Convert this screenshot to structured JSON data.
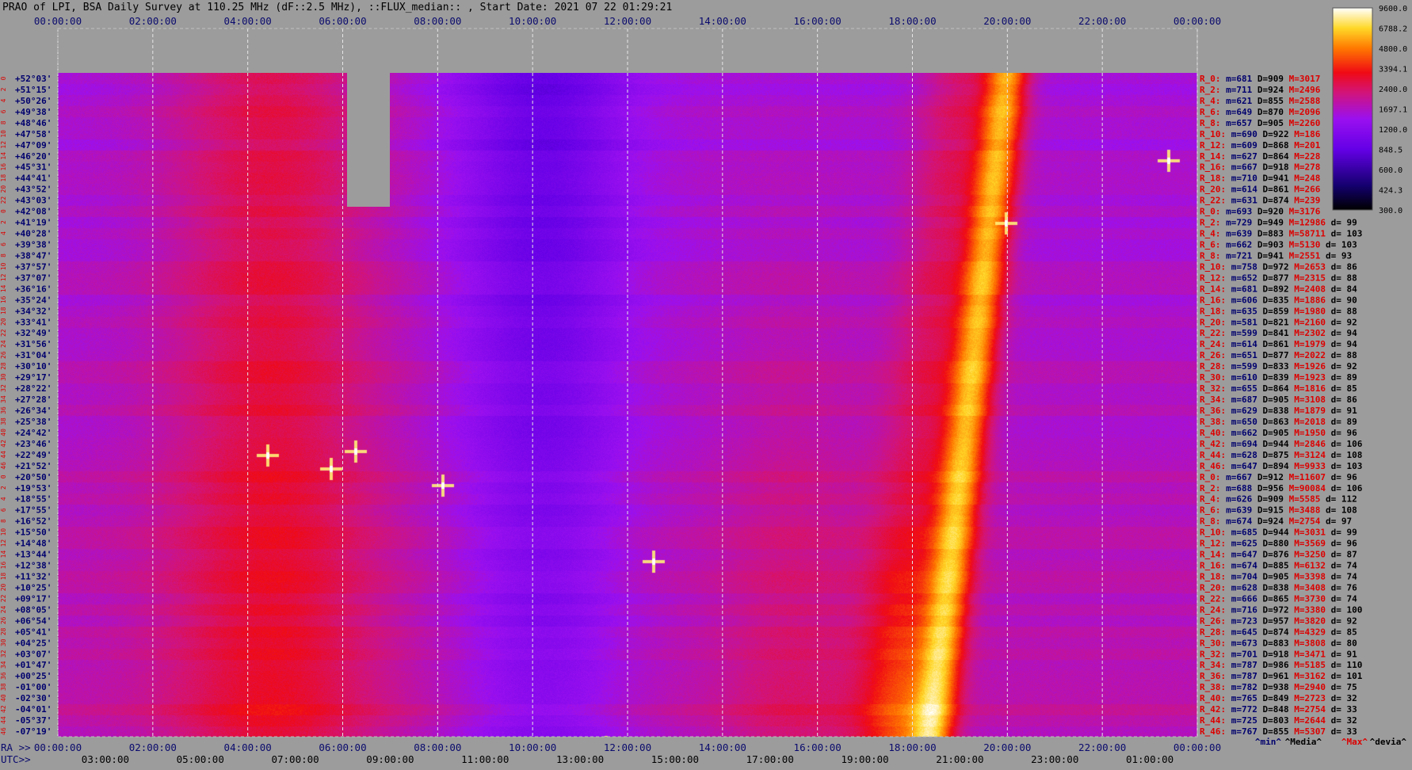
{
  "title": "PRAO of LPI, BSA Daily Survey at 110.25 MHz (dF::2.5 MHz), ::FLUX_median:: , Start Date: 2021 07 22 01:29:21",
  "colors": {
    "background": "#9c9c9c",
    "grid": "#e6e6e6",
    "label_dark": "#00006e",
    "label_red": "#dc0000"
  },
  "chart_data": {
    "type": "heatmap",
    "title": "PRAO of LPI, BSA Daily Survey at 110.25 MHz (dF::2.5 MHz), ::FLUX_median:: , Start Date: 2021 07 22 01:29:21",
    "top_axis_ticks": [
      "00:00:00",
      "02:00:00",
      "04:00:00",
      "06:00:00",
      "08:00:00",
      "10:00:00",
      "12:00:00",
      "14:00:00",
      "16:00:00",
      "18:00:00",
      "20:00:00",
      "22:00:00",
      "00:00:00"
    ],
    "ra_axis_prefix": "RA >>",
    "ra_axis_ticks": [
      "00:00:00",
      "02:00:00",
      "04:00:00",
      "06:00:00",
      "08:00:00",
      "10:00:00",
      "12:00:00",
      "14:00:00",
      "16:00:00",
      "18:00:00",
      "20:00:00",
      "22:00:00",
      "00:00:00"
    ],
    "utc_axis_prefix": "UTC>>",
    "utc_axis_ticks": [
      "03:00:00",
      "05:00:00",
      "07:00:00",
      "09:00:00",
      "11:00:00",
      "13:00:00",
      "15:00:00",
      "17:00:00",
      "19:00:00",
      "21:00:00",
      "23:00:00",
      "01:00:00"
    ],
    "declinations": [
      "+52°03'",
      "+51°15'",
      "+50°26'",
      "+49°38'",
      "+48°46'",
      "+47°58'",
      "+47°09'",
      "+46°20'",
      "+45°31'",
      "+44°41'",
      "+43°52'",
      "+43°03'",
      "+42°08'",
      "+41°19'",
      "+40°28'",
      "+39°38'",
      "+38°47'",
      "+37°57'",
      "+37°07'",
      "+36°16'",
      "+35°24'",
      "+34°32'",
      "+33°41'",
      "+32°49'",
      "+31°56'",
      "+31°04'",
      "+30°10'",
      "+29°17'",
      "+28°22'",
      "+27°28'",
      "+26°34'",
      "+25°38'",
      "+24°42'",
      "+23°46'",
      "+22°49'",
      "+21°52'",
      "+20°50'",
      "+19°53'",
      "+18°55'",
      "+17°55'",
      "+16°52'",
      "+15°50'",
      "+14°48'",
      "+13°44'",
      "+12°38'",
      "+11°32'",
      "+10°25'",
      "+09°17'",
      "+08°05'",
      "+06°54'",
      "+05°41'",
      "+04°25'",
      "+03°07'",
      "+01°47'",
      "+00°25'",
      "-01°00'",
      "-02°30'",
      "-04°01'",
      "-05°37'",
      "-07°19'"
    ],
    "beam_numbers": [
      "0",
      "2",
      "4",
      "6",
      "8",
      "10",
      "12",
      "14",
      "16",
      "18",
      "20",
      "22",
      "0",
      "2",
      "4",
      "6",
      "8",
      "10",
      "12",
      "14",
      "16",
      "18",
      "20",
      "22",
      "24",
      "26",
      "28",
      "30",
      "32",
      "34",
      "36",
      "38",
      "40",
      "42",
      "44",
      "46",
      "0",
      "2",
      "4",
      "6",
      "8",
      "10",
      "12",
      "14",
      "16",
      "18",
      "20",
      "22",
      "24",
      "26",
      "28",
      "30",
      "32",
      "34",
      "36",
      "38",
      "40",
      "42",
      "44",
      "46"
    ],
    "colorbar": {
      "ticks": [
        "9600.0",
        "6788.2",
        "4800.0",
        "3394.1",
        "2400.0",
        "1697.1",
        "1200.0",
        "848.5",
        "600.0",
        "424.3",
        "300.0"
      ],
      "range": [
        300,
        9600
      ],
      "scale": "log"
    },
    "row_stats": [
      {
        "beam": "R_0:",
        "m": "681",
        "D": "909",
        "M": "3017",
        "d": ""
      },
      {
        "beam": "R_2:",
        "m": "711",
        "D": "924",
        "M": "2496",
        "d": ""
      },
      {
        "beam": "R_4:",
        "m": "621",
        "D": "855",
        "M": "2588",
        "d": ""
      },
      {
        "beam": "R_6:",
        "m": "649",
        "D": "870",
        "M": "2096",
        "d": ""
      },
      {
        "beam": "R_8:",
        "m": "657",
        "D": "905",
        "M": "2260",
        "d": ""
      },
      {
        "beam": "R_10:",
        "m": "690",
        "D": "922",
        "M": "186",
        "d": ""
      },
      {
        "beam": "R_12:",
        "m": "609",
        "D": "868",
        "M": "201",
        "d": ""
      },
      {
        "beam": "R_14:",
        "m": "627",
        "D": "864",
        "M": "228",
        "d": ""
      },
      {
        "beam": "R_16:",
        "m": "667",
        "D": "918",
        "M": "278",
        "d": ""
      },
      {
        "beam": "R_18:",
        "m": "710",
        "D": "941",
        "M": "248",
        "d": ""
      },
      {
        "beam": "R_20:",
        "m": "614",
        "D": "861",
        "M": "266",
        "d": ""
      },
      {
        "beam": "R_22:",
        "m": "631",
        "D": "874",
        "M": "239",
        "d": ""
      },
      {
        "beam": "R_0:",
        "m": "693",
        "D": "920",
        "M": "3176",
        "d": ""
      },
      {
        "beam": "R_2:",
        "m": "729",
        "D": "949",
        "M": "12986",
        "d": "99"
      },
      {
        "beam": "R_4:",
        "m": "639",
        "D": "883",
        "M": "58711",
        "d": "103"
      },
      {
        "beam": "R_6:",
        "m": "662",
        "D": "903",
        "M": "5130",
        "d": "103"
      },
      {
        "beam": "R_8:",
        "m": "721",
        "D": "941",
        "M": "2551",
        "d": "93"
      },
      {
        "beam": "R_10:",
        "m": "758",
        "D": "972",
        "M": "2653",
        "d": "86"
      },
      {
        "beam": "R_12:",
        "m": "652",
        "D": "877",
        "M": "2315",
        "d": "88"
      },
      {
        "beam": "R_14:",
        "m": "681",
        "D": "892",
        "M": "2408",
        "d": "84"
      },
      {
        "beam": "R_16:",
        "m": "606",
        "D": "835",
        "M": "1886",
        "d": "90"
      },
      {
        "beam": "R_18:",
        "m": "635",
        "D": "859",
        "M": "1980",
        "d": "88"
      },
      {
        "beam": "R_20:",
        "m": "581",
        "D": "821",
        "M": "2160",
        "d": "92"
      },
      {
        "beam": "R_22:",
        "m": "599",
        "D": "841",
        "M": "2302",
        "d": "94"
      },
      {
        "beam": "R_24:",
        "m": "614",
        "D": "861",
        "M": "1979",
        "d": "94"
      },
      {
        "beam": "R_26:",
        "m": "651",
        "D": "877",
        "M": "2022",
        "d": "88"
      },
      {
        "beam": "R_28:",
        "m": "599",
        "D": "833",
        "M": "1926",
        "d": "92"
      },
      {
        "beam": "R_30:",
        "m": "610",
        "D": "839",
        "M": "1923",
        "d": "89"
      },
      {
        "beam": "R_32:",
        "m": "655",
        "D": "864",
        "M": "1816",
        "d": "85"
      },
      {
        "beam": "R_34:",
        "m": "687",
        "D": "905",
        "M": "3108",
        "d": "86"
      },
      {
        "beam": "R_36:",
        "m": "629",
        "D": "838",
        "M": "1879",
        "d": "91"
      },
      {
        "beam": "R_38:",
        "m": "650",
        "D": "863",
        "M": "2018",
        "d": "89"
      },
      {
        "beam": "R_40:",
        "m": "662",
        "D": "905",
        "M": "1950",
        "d": "96"
      },
      {
        "beam": "R_42:",
        "m": "694",
        "D": "944",
        "M": "2846",
        "d": "106"
      },
      {
        "beam": "R_44:",
        "m": "628",
        "D": "875",
        "M": "3124",
        "d": "108"
      },
      {
        "beam": "R_46:",
        "m": "647",
        "D": "894",
        "M": "9933",
        "d": "103"
      },
      {
        "beam": "R_0:",
        "m": "667",
        "D": "912",
        "M": "11607",
        "d": "96"
      },
      {
        "beam": "R_2:",
        "m": "688",
        "D": "956",
        "M": "90084",
        "d": "106"
      },
      {
        "beam": "R_4:",
        "m": "626",
        "D": "909",
        "M": "5585",
        "d": "112"
      },
      {
        "beam": "R_6:",
        "m": "639",
        "D": "915",
        "M": "3488",
        "d": "108"
      },
      {
        "beam": "R_8:",
        "m": "674",
        "D": "924",
        "M": "2754",
        "d": "97"
      },
      {
        "beam": "R_10:",
        "m": "685",
        "D": "944",
        "M": "3031",
        "d": "99"
      },
      {
        "beam": "R_12:",
        "m": "625",
        "D": "880",
        "M": "3569",
        "d": "96"
      },
      {
        "beam": "R_14:",
        "m": "647",
        "D": "876",
        "M": "3250",
        "d": "87"
      },
      {
        "beam": "R_16:",
        "m": "674",
        "D": "885",
        "M": "6132",
        "d": "74"
      },
      {
        "beam": "R_18:",
        "m": "704",
        "D": "905",
        "M": "3398",
        "d": "74"
      },
      {
        "beam": "R_20:",
        "m": "628",
        "D": "838",
        "M": "3408",
        "d": "76"
      },
      {
        "beam": "R_22:",
        "m": "666",
        "D": "865",
        "M": "3730",
        "d": "74"
      },
      {
        "beam": "R_24:",
        "m": "716",
        "D": "972",
        "M": "3380",
        "d": "100"
      },
      {
        "beam": "R_26:",
        "m": "723",
        "D": "957",
        "M": "3820",
        "d": "92"
      },
      {
        "beam": "R_28:",
        "m": "645",
        "D": "874",
        "M": "4329",
        "d": "85"
      },
      {
        "beam": "R_30:",
        "m": "673",
        "D": "883",
        "M": "3808",
        "d": "80"
      },
      {
        "beam": "R_32:",
        "m": "701",
        "D": "918",
        "M": "3471",
        "d": "91"
      },
      {
        "beam": "R_34:",
        "m": "787",
        "D": "986",
        "M": "5185",
        "d": "110"
      },
      {
        "beam": "R_36:",
        "m": "787",
        "D": "961",
        "M": "3162",
        "d": "101"
      },
      {
        "beam": "R_38:",
        "m": "782",
        "D": "938",
        "M": "2940",
        "d": "75"
      },
      {
        "beam": "R_40:",
        "m": "765",
        "D": "849",
        "M": "2723",
        "d": "32"
      },
      {
        "beam": "R_42:",
        "m": "772",
        "D": "848",
        "M": "2754",
        "d": "33"
      },
      {
        "beam": "R_44:",
        "m": "725",
        "D": "803",
        "M": "2644",
        "d": "32"
      },
      {
        "beam": "R_46:",
        "m": "767",
        "D": "855",
        "M": "5307",
        "d": "33"
      }
    ],
    "stats_legend": [
      "^min^",
      "^Media^",
      "^Max^",
      "^devia^"
    ]
  }
}
